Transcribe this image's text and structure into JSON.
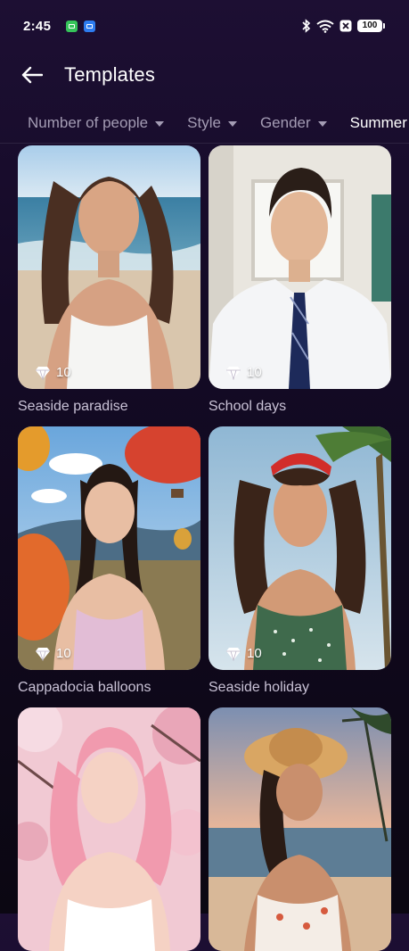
{
  "status": {
    "time": "2:45",
    "battery": "100"
  },
  "header": {
    "title": "Templates"
  },
  "filters": [
    {
      "label": "Number of people",
      "dropdown": true
    },
    {
      "label": "Style",
      "dropdown": true
    },
    {
      "label": "Gender",
      "dropdown": true
    },
    {
      "label": "Summer",
      "dropdown": false
    }
  ],
  "templates": [
    {
      "title": "Seaside paradise",
      "cost": "10"
    },
    {
      "title": "School days",
      "cost": "10"
    },
    {
      "title": "Cappadocia balloons",
      "cost": "10"
    },
    {
      "title": "Seaside holiday",
      "cost": "10"
    },
    {
      "title": "",
      "cost": ""
    },
    {
      "title": "",
      "cost": ""
    }
  ],
  "colors": {
    "background_top": "#1d0f33",
    "background_bottom": "#0b0712",
    "filter_inactive": "#a49cb4",
    "card_title": "#c9c2d6"
  }
}
